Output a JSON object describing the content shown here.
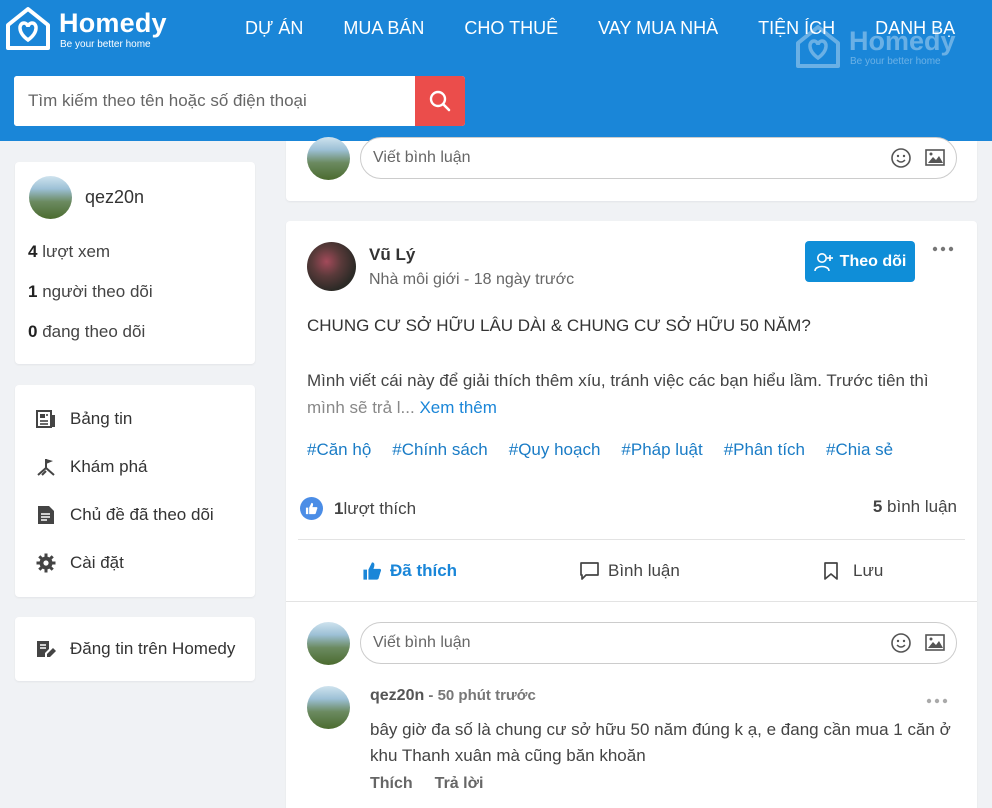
{
  "brand": {
    "name": "Homedy",
    "tagline": "Be your better home"
  },
  "nav": [
    "DỰ ÁN",
    "MUA BÁN",
    "CHO THUÊ",
    "VAY MUA NHÀ",
    "TIỆN ÍCH",
    "DANH BẠ"
  ],
  "search": {
    "placeholder": "Tìm kiếm theo tên hoặc số điện thoại"
  },
  "profile": {
    "name": "qez20n",
    "views": {
      "count": "4",
      "label": " lượt xem"
    },
    "followers": {
      "count": "1",
      "label": " người theo dõi"
    },
    "following": {
      "count": "0",
      "label": " đang theo dõi"
    }
  },
  "menu": [
    {
      "label": "Bảng tin",
      "icon": "newspaper-icon"
    },
    {
      "label": "Khám phá",
      "icon": "explore-icon"
    },
    {
      "label": "Chủ đề đã theo dõi",
      "icon": "document-icon"
    },
    {
      "label": "Cài đặt",
      "icon": "gear-icon"
    }
  ],
  "post_cta": {
    "label": "Đăng tin trên Homedy",
    "icon": "edit-note-icon"
  },
  "comment_placeholder": "Viết bình luận",
  "post": {
    "author": "Vũ Lý",
    "meta": "Nhà môi giới - 18 ngày trước",
    "follow_label": "Theo dõi",
    "title": "CHUNG CƯ SỞ HỮU LÂU DÀI & CHUNG CƯ SỞ HỮU 50 NĂM?",
    "body_line1": "Mình viết cái này để giải thích thêm xíu, tránh việc các bạn hiểu lầm. Trước tiên thì",
    "body_line2": "mình sẽ trả l...",
    "see_more": "Xem thêm",
    "tags": [
      "#Căn hộ",
      "#Chính sách",
      "#Quy hoạch",
      "#Pháp luật",
      "#Phân tích",
      "#Chia sẻ"
    ],
    "likes": {
      "count": "1",
      "label": " lượt thích"
    },
    "comments": {
      "count": "5",
      "label": " bình luận"
    },
    "actions": {
      "liked": "Đã thích",
      "comment": "Bình luận",
      "save": "Lưu"
    }
  },
  "comment": {
    "author": "qez20n",
    "ago": " - 50 phút trước",
    "text": "bây giờ đa số là chung cư sở hữu 50 năm đúng k ạ, e đang cần mua 1 căn ở khu Thanh xuân mà cũng băn khoăn",
    "like": "Thích",
    "reply": "Trả lời"
  },
  "colors": {
    "header": "#1a86d8",
    "search_button": "#eb4d4b",
    "follow_button": "#0f8ed8",
    "link": "#1a7cc6"
  }
}
